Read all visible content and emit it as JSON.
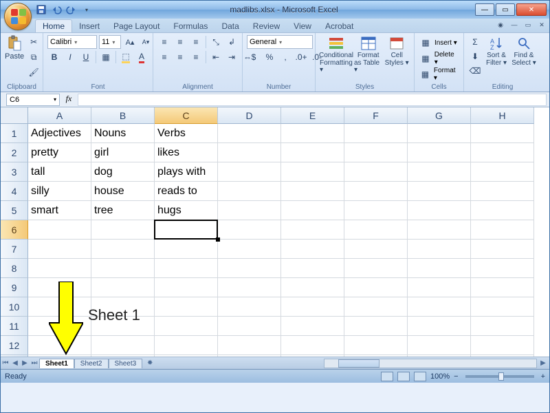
{
  "titlebar": {
    "title": "madlibs.xlsx - Microsoft Excel"
  },
  "tabs": {
    "items": [
      "Home",
      "Insert",
      "Page Layout",
      "Formulas",
      "Data",
      "Review",
      "View",
      "Acrobat"
    ],
    "active": "Home"
  },
  "ribbon": {
    "clipboard": {
      "label": "Clipboard",
      "paste": "Paste"
    },
    "font": {
      "label": "Font",
      "name": "Calibri",
      "size": "11",
      "bold": "B",
      "italic": "I",
      "underline": "U"
    },
    "alignment": {
      "label": "Alignment"
    },
    "number": {
      "label": "Number",
      "format": "General",
      "percent": "%"
    },
    "styles": {
      "label": "Styles",
      "cond": "Conditional Formatting ▾",
      "cond1": "Conditional",
      "cond2": "Formatting ▾",
      "table": "Format as Table ▾",
      "table1": "Format",
      "table2": "as Table ▾",
      "cellStyles": "Cell Styles ▾",
      "cell1": "Cell",
      "cell2": "Styles ▾"
    },
    "cells": {
      "label": "Cells",
      "insert": "Insert ▾",
      "delete": "Delete ▾",
      "format": "Format ▾"
    },
    "editing": {
      "label": "Editing",
      "sort": "Sort & Filter ▾",
      "sort1": "Sort &",
      "sort2": "Filter ▾",
      "find": "Find & Select ▾",
      "find1": "Find &",
      "find2": "Select ▾"
    }
  },
  "nameBox": "C6",
  "columns": [
    "A",
    "B",
    "C",
    "D",
    "E",
    "F",
    "G",
    "H"
  ],
  "rowCount": 13,
  "selectedCell": {
    "row": 6,
    "col": "C"
  },
  "cells": {
    "A1": "Adjectives",
    "B1": "Nouns",
    "C1": "Verbs",
    "A2": "pretty",
    "B2": "girl",
    "C2": "likes",
    "A3": "tall",
    "B3": "dog",
    "C3": "plays with",
    "A4": "silly",
    "B4": "house",
    "C4": "reads to",
    "A5": "smart",
    "B5": "tree",
    "C5": "hugs"
  },
  "sheetTabs": {
    "items": [
      "Sheet1",
      "Sheet2",
      "Sheet3"
    ],
    "active": "Sheet1"
  },
  "status": {
    "ready": "Ready",
    "zoom": "100%"
  },
  "annotation": {
    "label": "Sheet 1"
  }
}
